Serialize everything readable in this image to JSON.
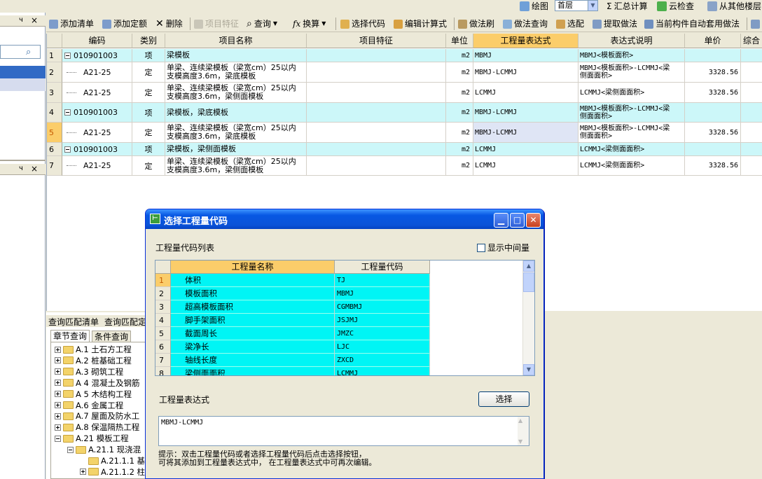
{
  "topbar": {
    "draw_label": "绘图",
    "floor_value": "首层",
    "calc_label": "汇总计算",
    "cloud_label": "云检查",
    "other_floor_label": "从其他楼层"
  },
  "left_panel": {
    "pin1": "ч",
    "close1": "×",
    "pin2": "ч",
    "close2": "×"
  },
  "toolbar": {
    "add_list": "添加清单",
    "add_quota": "添加定额",
    "delete": "删除",
    "item_feature": "项目特征",
    "query": "查询",
    "convert": "换算",
    "select_code": "选择代码",
    "edit_formula": "编辑计算式",
    "method_brush": "做法刷",
    "method_query": "做法查询",
    "select_match": "选配",
    "extract_method": "提取做法",
    "auto_apply": "当前构件自动套用做法"
  },
  "grid": {
    "headers": {
      "code": "编码",
      "type": "类别",
      "name": "项目名称",
      "feature": "项目特征",
      "unit": "单位",
      "expr": "工程量表达式",
      "desc": "表达式说明",
      "price": "单价",
      "total": "综合"
    },
    "rows": [
      {
        "num": "1",
        "code": "010901003",
        "type": "项",
        "name1": "梁模板",
        "name2": "",
        "unit": "m2",
        "expr": "MBMJ",
        "desc1": "MBMJ<模板面积>",
        "desc2": "",
        "price": ""
      },
      {
        "num": "2",
        "code": "A21-25",
        "type": "定",
        "name1": "单梁、连续梁模板（梁宽cm）25以内",
        "name2": "支模高度3.6m，梁底模板",
        "unit": "m2",
        "expr": "MBMJ-LCMMJ",
        "desc1": "MBMJ<模板面积>-LCMMJ<梁",
        "desc2": "侧面面积>",
        "price": "3328.56"
      },
      {
        "num": "3",
        "code": "A21-25",
        "type": "定",
        "name1": "单梁、连续梁模板（梁宽cm）25以内",
        "name2": "支模高度3.6m，梁侧面模板",
        "unit": "m2",
        "expr": "LCMMJ",
        "desc1": "LCMMJ<梁侧面面积>",
        "desc2": "",
        "price": "3328.56"
      },
      {
        "num": "4",
        "code": "010901003",
        "type": "项",
        "name1": "梁模板，梁底模板",
        "name2": "",
        "unit": "m2",
        "expr": "MBMJ-LCMMJ",
        "desc1": "MBMJ<模板面积>-LCMMJ<梁",
        "desc2": "侧面面积>",
        "price": ""
      },
      {
        "num": "5",
        "code": "A21-25",
        "type": "定",
        "name1": "单梁、连续梁模板（梁宽cm）25以内",
        "name2": "支模高度3.6m，梁底模板",
        "unit": "m2",
        "expr": "MBMJ-LCMMJ",
        "desc1": "MBMJ<模板面积>-LCMMJ<梁",
        "desc2": "侧面面积>",
        "price": "3328.56"
      },
      {
        "num": "6",
        "code": "010901003",
        "type": "项",
        "name1": "梁模板，梁侧面模板",
        "name2": "",
        "unit": "m2",
        "expr": "LCMMJ",
        "desc1": "LCMMJ<梁侧面面积>",
        "desc2": "",
        "price": ""
      },
      {
        "num": "7",
        "code": "A21-25",
        "type": "定",
        "name1": "单梁、连续梁模板（梁宽cm）25以内",
        "name2": "支模高度3.6m，梁侧面模板",
        "unit": "m2",
        "expr": "LCMMJ",
        "desc1": "LCMMJ<梁侧面面积>",
        "desc2": "",
        "price": "3328.56"
      }
    ]
  },
  "bottom": {
    "tab_list": "查询匹配清单",
    "tab_quota": "查询匹配定",
    "subtab_chapter": "章节查询",
    "subtab_condition": "条件查询",
    "tree": [
      "A.1 土石方工程",
      "A.2 桩基础工程",
      "A.3 砌筑工程",
      "A 4 混凝土及钢筋",
      "A 5 木结构工程",
      "A.6 金属工程",
      "A.7 屋面及防水工",
      "A.8 保温隔热工程",
      "A.21 模板工程",
      "A.21.1 现浇混",
      "A.21.1.1 基",
      "A.21.1.2 柱"
    ]
  },
  "dialog": {
    "title": "选择工程量代码",
    "list_label": "工程量代码列表",
    "show_intermediate": "显示中间量",
    "col_name": "工程量名称",
    "col_code": "工程量代码",
    "rows": [
      {
        "num": "1",
        "name": "体积",
        "code": "TJ"
      },
      {
        "num": "2",
        "name": "模板面积",
        "code": "MBMJ"
      },
      {
        "num": "3",
        "name": "超高模板面积",
        "code": "CGMBMJ"
      },
      {
        "num": "4",
        "name": "脚手架面积",
        "code": "JSJMJ"
      },
      {
        "num": "5",
        "name": "截面周长",
        "code": "JMZC"
      },
      {
        "num": "6",
        "name": "梁净长",
        "code": "LJC"
      },
      {
        "num": "7",
        "name": "轴线长度",
        "code": "ZXCD"
      },
      {
        "num": "8",
        "name": "梁侧面面积",
        "code": "LCMMJ"
      }
    ],
    "expr_label": "工程量表达式",
    "select_btn": "选择",
    "expr_value": "MBMJ-LCMMJ",
    "hint1": "提示：双击工程量代码或者选择工程量代码后点击选择按钮，",
    "hint2": "可将其添加到工程量表达式中， 在工程量表达式中可再次编辑。"
  }
}
